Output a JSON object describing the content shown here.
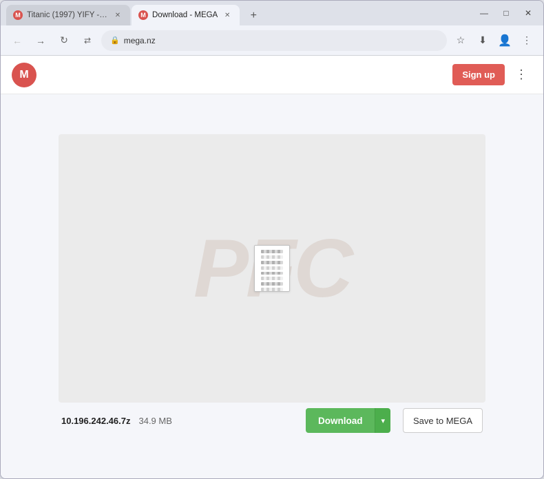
{
  "browser": {
    "tabs": [
      {
        "id": "tab1",
        "title": "Titanic (1997) YIFY - Download...",
        "favicon_color": "#d9534f",
        "favicon_letter": "M",
        "active": false
      },
      {
        "id": "tab2",
        "title": "Download - MEGA",
        "favicon_color": "#d9534f",
        "favicon_letter": "M",
        "active": true
      }
    ],
    "new_tab_label": "+",
    "url": "mega.nz",
    "window_controls": {
      "minimize": "—",
      "maximize": "□",
      "close": "✕"
    }
  },
  "mega": {
    "logo_letter": "M",
    "sign_up_label": "Sign up",
    "menu_icon": "⋮"
  },
  "file": {
    "name": "10.196.242.46.7z",
    "size": "34.9 MB",
    "download_label": "Download",
    "dropdown_arrow": "▾",
    "save_to_mega_label": "Save to MEGA"
  },
  "watermark": {
    "text": "PFC"
  }
}
